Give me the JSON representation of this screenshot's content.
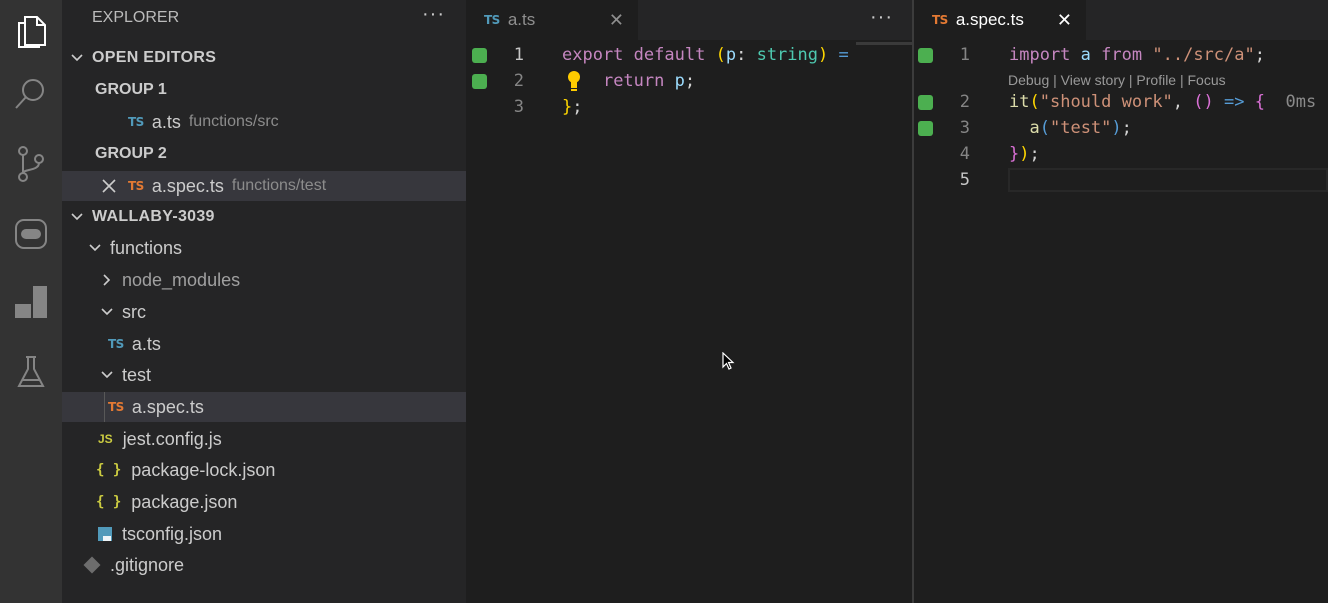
{
  "activity_bar": {
    "icons": [
      "files-icon",
      "search-icon",
      "source-control-icon",
      "remote-icon",
      "wallaby-icon",
      "testing-icon"
    ]
  },
  "explorer": {
    "title": "EXPLORER",
    "more_label": "···",
    "open_editors": {
      "title": "OPEN EDITORS",
      "group1": {
        "title": "GROUP 1",
        "file": {
          "badge": "TS",
          "name": "a.ts",
          "path": "functions/src"
        }
      },
      "group2": {
        "title": "GROUP 2",
        "file": {
          "badge": "TS",
          "name": "a.spec.ts",
          "path": "functions/test"
        }
      }
    },
    "workspace": {
      "title": "WALLABY-3039",
      "tree": {
        "functions": "functions",
        "node_modules": "node_modules",
        "src": "src",
        "src_file": {
          "badge": "TS",
          "name": "a.ts"
        },
        "test": "test",
        "test_file": {
          "badge": "TS",
          "name": "a.spec.ts"
        },
        "jest": {
          "badge": "JS",
          "name": "jest.config.js"
        },
        "pkg_lock": {
          "badge": "{ }",
          "name": "package-lock.json"
        },
        "pkg": {
          "badge": "{ }",
          "name": "package.json"
        },
        "tsconfig": {
          "name": "tsconfig.json"
        },
        "gitignore": {
          "name": ".gitignore"
        }
      }
    }
  },
  "editor_left": {
    "tab": {
      "badge": "TS",
      "label": "a.ts",
      "close": "✕"
    },
    "more_label": "···",
    "line_numbers": [
      "1",
      "2",
      "3"
    ]
  },
  "editor_right": {
    "tab": {
      "badge": "TS",
      "label": "a.spec.ts",
      "close": "✕"
    },
    "line_numbers": [
      "1",
      "2",
      "3",
      "4",
      "5"
    ],
    "codelens": "Debug | View story | Profile | Focus",
    "timing": "0ms"
  },
  "colors": {
    "coverage": "#4caf50",
    "ts_blue": "#519aba",
    "ts_orange": "#e37933",
    "json_yellow": "#cbcb41"
  }
}
